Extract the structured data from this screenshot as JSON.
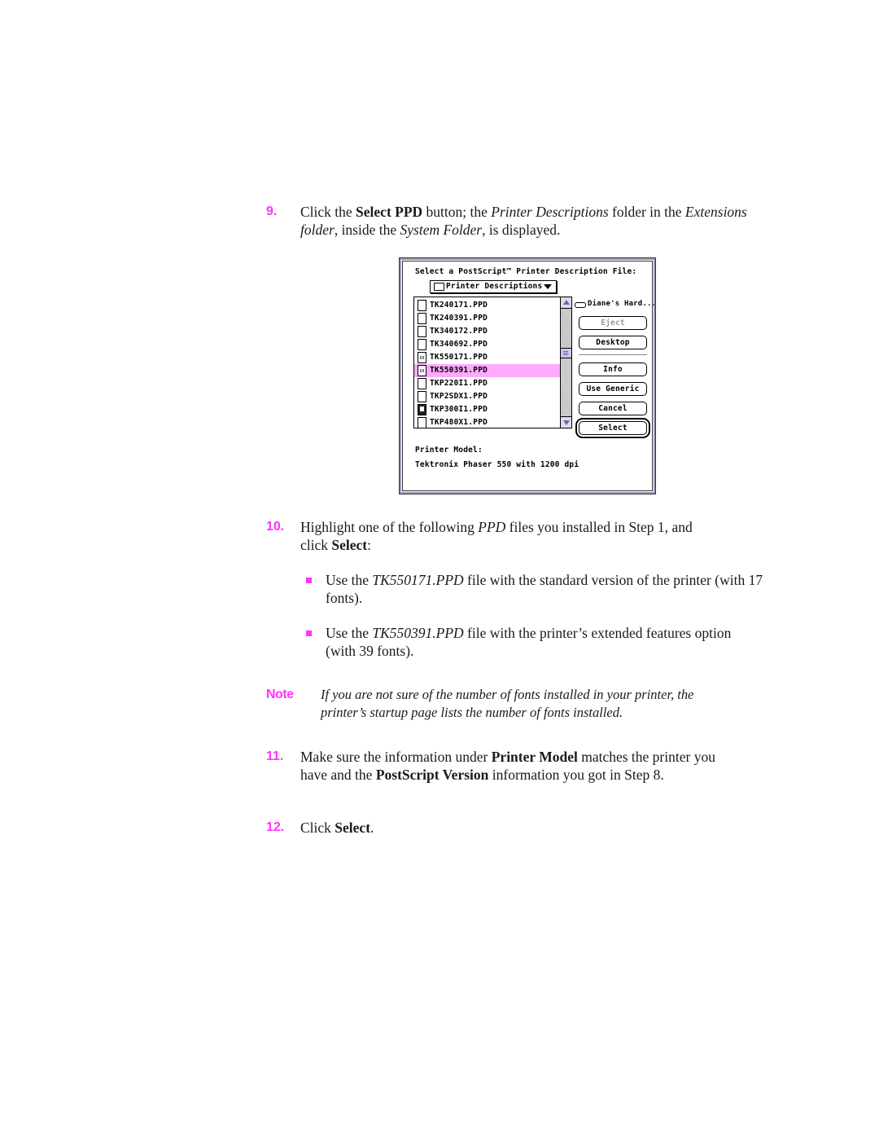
{
  "steps": [
    {
      "number": "9.",
      "segments": [
        {
          "t": "Click the ",
          "s": "n"
        },
        {
          "t": "Select PPD",
          "s": "b"
        },
        {
          "t": " button; the ",
          "s": "n"
        },
        {
          "t": "Printer Descriptions",
          "s": "i"
        },
        {
          "t": " folder in the ",
          "s": "n"
        },
        {
          "t": "Extensions folder",
          "s": "i"
        },
        {
          "t": ", inside the ",
          "s": "n"
        },
        {
          "t": "System Folder",
          "s": "i"
        },
        {
          "t": ", is displayed.",
          "s": "n"
        }
      ]
    },
    {
      "number": "10.",
      "segments": [
        {
          "t": "Highlight one of the following ",
          "s": "n"
        },
        {
          "t": "PPD",
          "s": "i"
        },
        {
          "t": " files you installed in Step 1, ",
          "s": "n"
        },
        {
          "t": "and click ",
          "s": "n"
        },
        {
          "t": "Select",
          "s": "b"
        },
        {
          "t": ":",
          "s": "n"
        }
      ]
    },
    {
      "number": "11.",
      "segments": [
        {
          "t": "Make sure the information under ",
          "s": "n"
        },
        {
          "t": "Printer Model",
          "s": "b"
        },
        {
          "t": " matches the printer you have and the ",
          "s": "n"
        },
        {
          "t": "PostScript Version",
          "s": "b"
        },
        {
          "t": " information you got in Step 8.",
          "s": "n"
        }
      ]
    },
    {
      "number": "12.",
      "segments": [
        {
          "t": "Click ",
          "s": "n"
        },
        {
          "t": "Select",
          "s": "b"
        },
        {
          "t": ".",
          "s": "n"
        }
      ]
    }
  ],
  "bullets": [
    {
      "segments": [
        {
          "t": "Use the ",
          "s": "n"
        },
        {
          "t": "TK550171.PPD",
          "s": "i"
        },
        {
          "t": " file with the standard version of the printer (with 17 fonts).",
          "s": "n"
        }
      ]
    },
    {
      "segments": [
        {
          "t": "Use the ",
          "s": "n"
        },
        {
          "t": "TK550391.PPD",
          "s": "i"
        },
        {
          "t": " file with the printer’s extended features option (with 39 fonts).",
          "s": "n"
        }
      ]
    }
  ],
  "note": {
    "label": "Note",
    "text": "If you are not sure of the number of fonts installed in your printer, the printer’s startup page lists the number of fonts installed."
  },
  "dialog": {
    "title": "Select a PostScript™ Printer Description File:",
    "folder_popup": "Printer Descriptions",
    "files": [
      {
        "name": "TK240171.PPD",
        "icon": "document",
        "selected": false
      },
      {
        "name": "TK240391.PPD",
        "icon": "document",
        "selected": false
      },
      {
        "name": "TK340172.PPD",
        "icon": "document",
        "selected": false
      },
      {
        "name": "TK340692.PPD",
        "icon": "document",
        "selected": false
      },
      {
        "name": "TK550171.PPD",
        "icon": "ppd-document",
        "selected": false
      },
      {
        "name": "TK550391.PPD",
        "icon": "ppd-document",
        "selected": true
      },
      {
        "name": "TKP220I1.PPD",
        "icon": "document",
        "selected": false
      },
      {
        "name": "TKP2SDX1.PPD",
        "icon": "document",
        "selected": false
      },
      {
        "name": "TKP300I1.PPD",
        "icon": "application",
        "selected": false
      },
      {
        "name": "TKP480X1.PPD",
        "icon": "document",
        "selected": false
      }
    ],
    "disk_name": "Diane's Hard...",
    "buttons": {
      "eject": "Eject",
      "desktop": "Desktop",
      "info": "Info",
      "use_generic": "Use Generic",
      "cancel": "Cancel",
      "select": "Select"
    },
    "printer_model_label": "Printer Model:",
    "printer_model_value": "Tektronix Phaser 550 with 1200 dpi"
  },
  "colors": {
    "accent": "#ff33ff",
    "selection": "#ffaaff"
  }
}
